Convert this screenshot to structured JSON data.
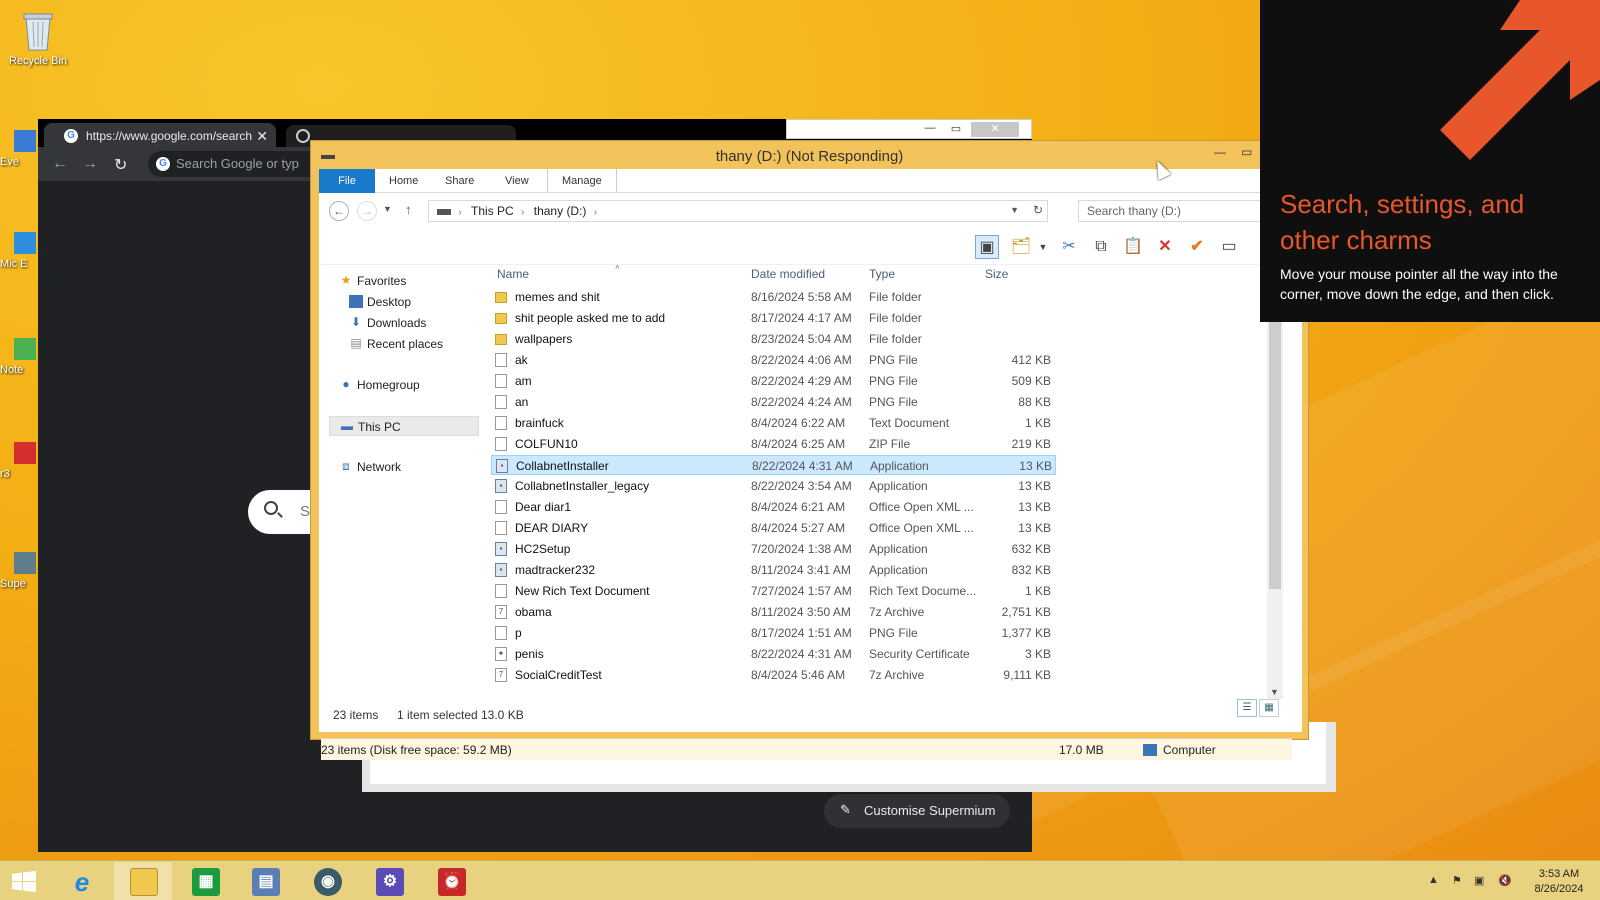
{
  "desktop": {
    "recycle_bin_label": "Recycle Bin",
    "partial_labels": [
      "Eve",
      "Mic\nE",
      "Note",
      "r3",
      "Supe"
    ]
  },
  "chrome": {
    "tab_url": "https://www.google.com/search",
    "omnibox_placeholder": "Search Google or typ",
    "search_partial": "S",
    "customise_label": "Customise Supermium"
  },
  "explorer": {
    "title": "thany (D:) (Not Responding)",
    "ribbon_tabs": [
      "File",
      "Home",
      "Share",
      "View",
      "Manage"
    ],
    "address_segments": [
      "This PC",
      "thany (D:)"
    ],
    "search_placeholder": "Search thany (D:)",
    "columns": {
      "name": "Name",
      "date": "Date modified",
      "type": "Type",
      "size": "Size"
    },
    "nav": {
      "favorites": "Favorites",
      "desktop": "Desktop",
      "downloads": "Downloads",
      "recent": "Recent places",
      "homegroup": "Homegroup",
      "thispc": "This PC",
      "network": "Network"
    },
    "files": [
      {
        "name": "memes and shit",
        "date": "8/16/2024 5:58 AM",
        "type": "File folder",
        "size": "",
        "icon": "folder"
      },
      {
        "name": "shit people asked me to add",
        "date": "8/17/2024 4:17 AM",
        "type": "File folder",
        "size": "",
        "icon": "folder"
      },
      {
        "name": "wallpapers",
        "date": "8/23/2024 5:04 AM",
        "type": "File folder",
        "size": "",
        "icon": "folder"
      },
      {
        "name": "ak",
        "date": "8/22/2024 4:06 AM",
        "type": "PNG File",
        "size": "412 KB",
        "icon": "file"
      },
      {
        "name": "am",
        "date": "8/22/2024 4:29 AM",
        "type": "PNG File",
        "size": "509 KB",
        "icon": "file"
      },
      {
        "name": "an",
        "date": "8/22/2024 4:24 AM",
        "type": "PNG File",
        "size": "88 KB",
        "icon": "file"
      },
      {
        "name": "brainfuck",
        "date": "8/4/2024 6:22 AM",
        "type": "Text Document",
        "size": "1 KB",
        "icon": "file"
      },
      {
        "name": "COLFUN10",
        "date": "8/4/2024 6:25 AM",
        "type": "ZIP File",
        "size": "219 KB",
        "icon": "file"
      },
      {
        "name": "CollabnetInstaller",
        "date": "8/22/2024 4:31 AM",
        "type": "Application",
        "size": "13 KB",
        "icon": "app",
        "selected": true
      },
      {
        "name": "CollabnetInstaller_legacy",
        "date": "8/22/2024 3:54 AM",
        "type": "Application",
        "size": "13 KB",
        "icon": "app"
      },
      {
        "name": "Dear diar1",
        "date": "8/4/2024 6:21 AM",
        "type": "Office Open XML ...",
        "size": "13 KB",
        "icon": "file"
      },
      {
        "name": "DEAR DIARY",
        "date": "8/4/2024 5:27 AM",
        "type": "Office Open XML ...",
        "size": "13 KB",
        "icon": "file"
      },
      {
        "name": "HC2Setup",
        "date": "7/20/2024 1:38 AM",
        "type": "Application",
        "size": "632 KB",
        "icon": "app"
      },
      {
        "name": "madtracker232",
        "date": "8/11/2024 3:41 AM",
        "type": "Application",
        "size": "832 KB",
        "icon": "app"
      },
      {
        "name": "New Rich Text Document",
        "date": "7/27/2024 1:57 AM",
        "type": "Rich Text Docume...",
        "size": "1 KB",
        "icon": "file"
      },
      {
        "name": "obama",
        "date": "8/11/2024 3:50 AM",
        "type": "7z Archive",
        "size": "2,751 KB",
        "icon": "archive"
      },
      {
        "name": "p",
        "date": "8/17/2024 1:51 AM",
        "type": "PNG File",
        "size": "1,377 KB",
        "icon": "file"
      },
      {
        "name": "penis",
        "date": "8/22/2024 4:31 AM",
        "type": "Security Certificate",
        "size": "3 KB",
        "icon": "cert"
      },
      {
        "name": "SocialCreditTest",
        "date": "8/4/2024 5:46 AM",
        "type": "7z Archive",
        "size": "9,111 KB",
        "icon": "archive"
      }
    ],
    "status": {
      "item_count": "23 items",
      "selected": "1 item selected",
      "selected_size": "13.0 KB",
      "disk_info": "23 items (Disk free space: 59.2 MB)",
      "total_size": "17.0 MB",
      "location": "Computer"
    }
  },
  "charms": {
    "title": "Search, settings, and other charms",
    "body": "Move your mouse pointer all the way into the corner, move down the edge, and then click.",
    "accent": "#e8562b"
  },
  "taskbar": {
    "time": "3:53 AM",
    "date": "8/26/2024"
  }
}
